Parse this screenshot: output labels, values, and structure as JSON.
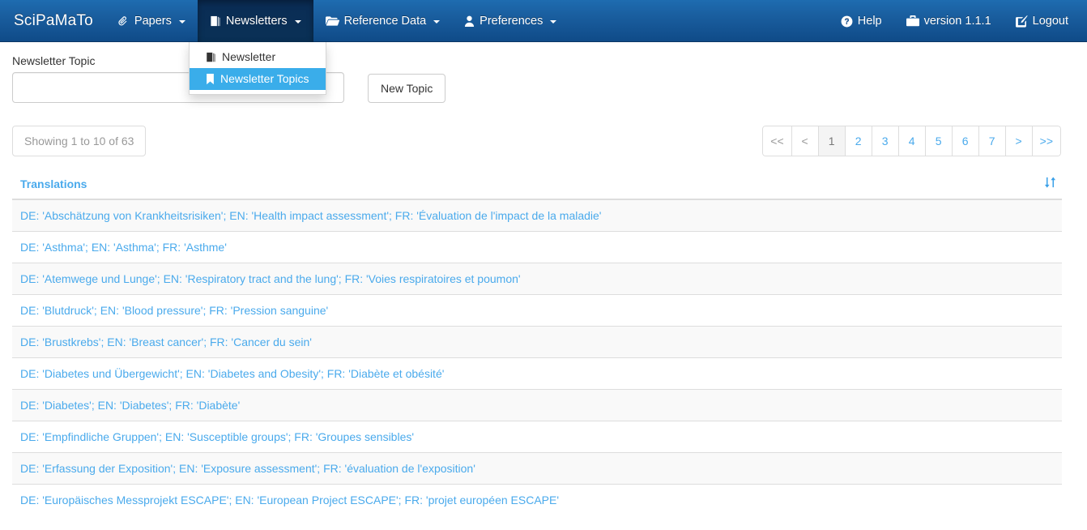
{
  "navbar": {
    "brand": "SciPaMaTo",
    "left_items": [
      {
        "label": "Papers",
        "icon": "paperclip-icon",
        "caret": true,
        "active": false
      },
      {
        "label": "Newsletters",
        "icon": "book-icon",
        "caret": true,
        "active": true
      },
      {
        "label": "Reference Data",
        "icon": "folder-open-icon",
        "caret": true,
        "active": false
      },
      {
        "label": "Preferences",
        "icon": "user-icon",
        "caret": true,
        "active": false
      }
    ],
    "right_items": [
      {
        "label": "Help",
        "icon": "question-circle-icon"
      },
      {
        "label": "version 1.1.1",
        "icon": "briefcase-icon"
      },
      {
        "label": "Logout",
        "icon": "pencil-square-icon"
      }
    ],
    "accent_active_bg": "#0a2c55",
    "gradient_top": "#1e6cb0",
    "gradient_bottom": "#0f4a87"
  },
  "dropdown": {
    "open_for": "Newsletters",
    "items": [
      {
        "label": "Newsletter",
        "icon": "book-icon",
        "highlighted": false
      },
      {
        "label": "Newsletter Topics",
        "icon": "bookmark-icon",
        "highlighted": true
      }
    ],
    "highlight_color": "#3aadea"
  },
  "form": {
    "topic_label": "Newsletter Topic",
    "topic_value": "",
    "topic_placeholder": "",
    "new_topic_button": "New Topic"
  },
  "table_top": {
    "showing_text": "Showing 1 to 10 of 63"
  },
  "pagination": {
    "items": [
      {
        "label": "<<",
        "state": "muted"
      },
      {
        "label": "<",
        "state": "muted"
      },
      {
        "label": "1",
        "state": "active"
      },
      {
        "label": "2",
        "state": "link"
      },
      {
        "label": "3",
        "state": "link"
      },
      {
        "label": "4",
        "state": "link"
      },
      {
        "label": "5",
        "state": "link"
      },
      {
        "label": "6",
        "state": "link"
      },
      {
        "label": "7",
        "state": "link"
      },
      {
        "label": ">",
        "state": "link"
      },
      {
        "label": ">>",
        "state": "link"
      }
    ]
  },
  "table": {
    "column_header": "Translations",
    "sort_icon": "sort-icon",
    "link_color": "#4aaaec",
    "rows": [
      {
        "translations": "DE: 'Abschätzung von Krankheitsrisiken'; EN: 'Health impact assessment'; FR: 'Évaluation de l'impact de la maladie'"
      },
      {
        "translations": "DE: 'Asthma'; EN: 'Asthma'; FR: 'Asthme'"
      },
      {
        "translations": "DE: 'Atemwege und Lunge'; EN: 'Respiratory tract and the lung'; FR: 'Voies respiratoires et poumon'"
      },
      {
        "translations": "DE: 'Blutdruck'; EN: 'Blood pressure'; FR: 'Pression sanguine'"
      },
      {
        "translations": "DE: 'Brustkrebs'; EN: 'Breast cancer'; FR: 'Cancer du sein'"
      },
      {
        "translations": "DE: 'Diabetes und Übergewicht'; EN: 'Diabetes and Obesity'; FR: 'Diabète et obésité'"
      },
      {
        "translations": "DE: 'Diabetes'; EN: 'Diabetes'; FR: 'Diabète'"
      },
      {
        "translations": "DE: 'Empfindliche Gruppen'; EN: 'Susceptible groups'; FR: 'Groupes sensibles'"
      },
      {
        "translations": "DE: 'Erfassung der Exposition'; EN: 'Exposure assessment'; FR: 'évaluation de l'exposition'"
      },
      {
        "translations": "DE: 'Europäisches Messprojekt ESCAPE'; EN: 'European Project ESCAPE'; FR: 'projet européen ESCAPE'"
      }
    ]
  }
}
